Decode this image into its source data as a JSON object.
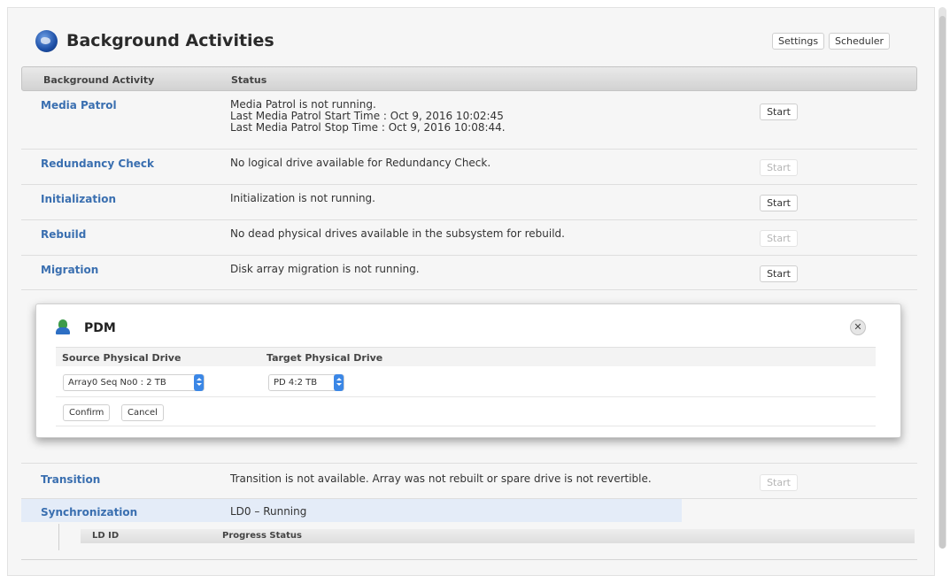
{
  "header": {
    "title": "Background Activities",
    "icon": "globe-icon",
    "settings_label": "Settings",
    "scheduler_label": "Scheduler"
  },
  "table": {
    "col_activity": "Background Activity",
    "col_status": "Status",
    "start_label": "Start",
    "rows": [
      {
        "name": "Media Patrol",
        "status_lines": [
          "Media Patrol is not running.",
          "Last Media Patrol Start Time : Oct 9, 2016 10:02:45",
          "Last Media Patrol Stop Time : Oct 9, 2016 10:08:44."
        ],
        "start_enabled": true
      },
      {
        "name": "Redundancy Check",
        "status_lines": [
          "No logical drive available for Redundancy Check."
        ],
        "start_enabled": false
      },
      {
        "name": "Initialization",
        "status_lines": [
          "Initialization is not running."
        ],
        "start_enabled": true
      },
      {
        "name": "Rebuild",
        "status_lines": [
          "No dead physical drives available in the subsystem for rebuild."
        ],
        "start_enabled": false
      },
      {
        "name": "Migration",
        "status_lines": [
          "Disk array migration is not running."
        ],
        "start_enabled": true
      },
      {
        "name": "Transition",
        "status_lines": [
          "Transition is not available. Array was not rebuilt or spare drive is not revertible."
        ],
        "start_enabled": false
      },
      {
        "name": "Synchronization",
        "status_lines": [
          "LD0 – Running"
        ],
        "start_enabled": null
      }
    ]
  },
  "pdm": {
    "title": "PDM",
    "icon": "user-icon",
    "source_header": "Source Physical Drive",
    "target_header": "Target Physical Drive",
    "source_value": "Array0 Seq No0 : 2 TB",
    "target_value": "PD 4:2 TB",
    "confirm_label": "Confirm",
    "cancel_label": "Cancel"
  },
  "sync_table": {
    "col_ldid": "LD ID",
    "col_progress": "Progress Status"
  },
  "colors": {
    "link": "#3a6fb0",
    "select_accent": "#3b87e6",
    "row_highlight": "#e4ecf8"
  }
}
